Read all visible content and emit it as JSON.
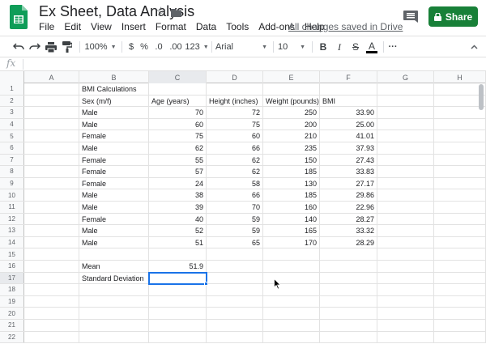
{
  "titlebar": {
    "doc_title": "Ex Sheet, Data Analysis",
    "save_status": "All changes saved in Drive",
    "share_label": "Share",
    "menu": [
      "File",
      "Edit",
      "View",
      "Insert",
      "Format",
      "Data",
      "Tools",
      "Add-ons",
      "Help"
    ]
  },
  "toolbar": {
    "zoom": "100%",
    "currency": "$",
    "percent": "%",
    "decimal_decrease": ".0",
    "decimal_increase": ".00",
    "more_formats": "123",
    "font": "Arial",
    "font_size": "10",
    "bold": "B",
    "italic": "I",
    "strike": "S",
    "text_color": "A",
    "more": "···"
  },
  "formula_bar": {
    "fx": "fx",
    "value": ""
  },
  "grid": {
    "columns": [
      "A",
      "B",
      "C",
      "D",
      "E",
      "F",
      "G",
      "H"
    ],
    "active_column": "C",
    "active_row": 17,
    "rows": [
      {
        "n": "1",
        "cells": [
          "",
          "BMI Calculations",
          "",
          "",
          "",
          "",
          "",
          ""
        ]
      },
      {
        "n": "2",
        "cells": [
          "",
          "Sex (m/f)",
          "Age (years)",
          "Height (inches)",
          "Weight (pounds)",
          "BMI",
          "",
          ""
        ]
      },
      {
        "n": "3",
        "cells": [
          "",
          "Male",
          "70",
          "72",
          "250",
          "33.90",
          "",
          ""
        ]
      },
      {
        "n": "4",
        "cells": [
          "",
          "Male",
          "60",
          "75",
          "200",
          "25.00",
          "",
          ""
        ]
      },
      {
        "n": "5",
        "cells": [
          "",
          "Female",
          "75",
          "60",
          "210",
          "41.01",
          "",
          ""
        ]
      },
      {
        "n": "6",
        "cells": [
          "",
          "Male",
          "62",
          "66",
          "235",
          "37.93",
          "",
          ""
        ]
      },
      {
        "n": "7",
        "cells": [
          "",
          "Female",
          "55",
          "62",
          "150",
          "27.43",
          "",
          ""
        ]
      },
      {
        "n": "8",
        "cells": [
          "",
          "Female",
          "57",
          "62",
          "185",
          "33.83",
          "",
          ""
        ]
      },
      {
        "n": "9",
        "cells": [
          "",
          "Female",
          "24",
          "58",
          "130",
          "27.17",
          "",
          ""
        ]
      },
      {
        "n": "10",
        "cells": [
          "",
          "Male",
          "38",
          "66",
          "185",
          "29.86",
          "",
          ""
        ]
      },
      {
        "n": "11",
        "cells": [
          "",
          "Male",
          "39",
          "70",
          "160",
          "22.96",
          "",
          ""
        ]
      },
      {
        "n": "12",
        "cells": [
          "",
          "Female",
          "40",
          "59",
          "140",
          "28.27",
          "",
          ""
        ]
      },
      {
        "n": "13",
        "cells": [
          "",
          "Male",
          "52",
          "59",
          "165",
          "33.32",
          "",
          ""
        ]
      },
      {
        "n": "14",
        "cells": [
          "",
          "Male",
          "51",
          "65",
          "170",
          "28.29",
          "",
          ""
        ]
      },
      {
        "n": "15",
        "cells": [
          "",
          "",
          "",
          "",
          "",
          "",
          "",
          ""
        ]
      },
      {
        "n": "16",
        "cells": [
          "",
          "Mean",
          "51.9",
          "",
          "",
          "",
          "",
          ""
        ]
      },
      {
        "n": "17",
        "cells": [
          "",
          "Standard Deviation",
          "",
          "",
          "",
          "",
          "",
          ""
        ]
      },
      {
        "n": "18",
        "cells": [
          "",
          "",
          "",
          "",
          "",
          "",
          "",
          ""
        ]
      },
      {
        "n": "19",
        "cells": [
          "",
          "",
          "",
          "",
          "",
          "",
          "",
          ""
        ]
      },
      {
        "n": "20",
        "cells": [
          "",
          "",
          "",
          "",
          "",
          "",
          "",
          ""
        ]
      },
      {
        "n": "21",
        "cells": [
          "",
          "",
          "",
          "",
          "",
          "",
          "",
          ""
        ]
      },
      {
        "n": "22",
        "cells": [
          "",
          "",
          "",
          "",
          "",
          "",
          "",
          ""
        ]
      }
    ]
  },
  "colors": {
    "share_green": "#188038",
    "selection_blue": "#1a73e8",
    "sheets_green": "#0f9d58"
  }
}
